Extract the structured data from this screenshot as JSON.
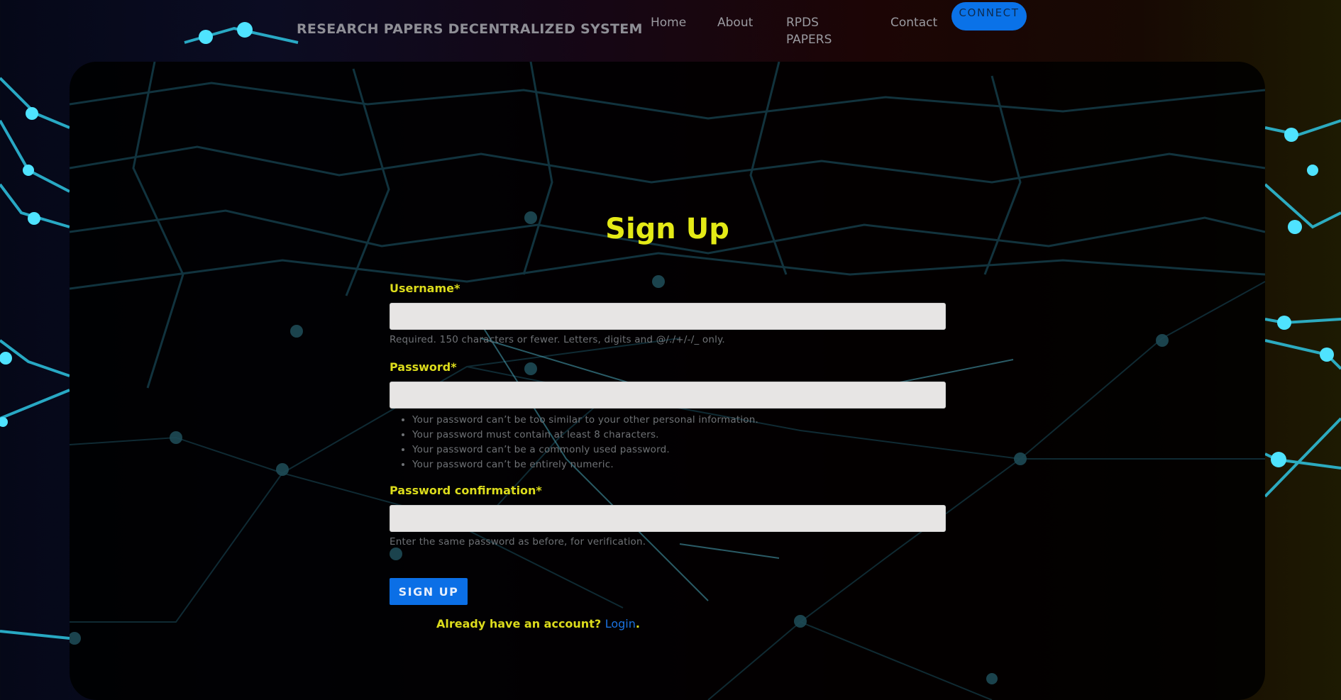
{
  "navbar": {
    "brand": "RESEARCH PAPERS DECENTRALIZED SYSTEM",
    "links": [
      {
        "label": "Home"
      },
      {
        "label": "About"
      },
      {
        "label": "RPDS PAPERS"
      },
      {
        "label": "Contact"
      }
    ],
    "connect_label": "CONNECT"
  },
  "form": {
    "title": "Sign Up",
    "username": {
      "label": "Username*",
      "value": "",
      "help": "Required. 150 characters or fewer. Letters, digits and @/./+/-/_ only."
    },
    "password": {
      "label": "Password*",
      "value": "",
      "rules": [
        "Your password can’t be too similar to your other personal information.",
        "Your password must contain at least 8 characters.",
        "Your password can’t be a commonly used password.",
        "Your password can’t be entirely numeric."
      ]
    },
    "password_confirmation": {
      "label": "Password confirmation*",
      "value": "",
      "help": "Enter the same password as before, for verification."
    },
    "submit_label": "SIGN UP",
    "login_prompt": "Already have an account?",
    "login_link": "Login",
    "login_suffix": "."
  },
  "colors": {
    "accent_yellow": "#dcdc1c",
    "button_blue": "#0b6fe6",
    "network_cyan": "#35d6f2"
  }
}
